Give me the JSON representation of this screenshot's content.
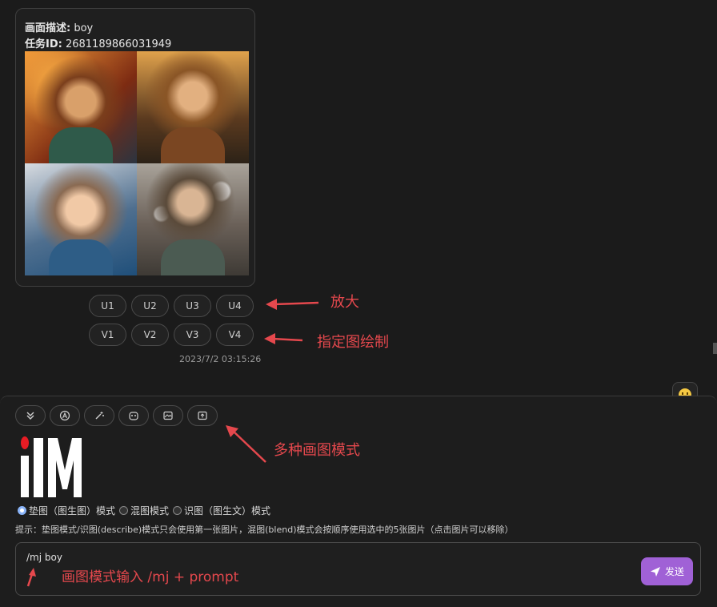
{
  "message": {
    "desc_label": "画面描述:",
    "desc_value": "boy",
    "task_label": "任务ID:",
    "task_value": "2681189866031949",
    "timestamp": "2023/7/2 03:15:26"
  },
  "upscale_buttons": [
    "U1",
    "U2",
    "U3",
    "U4"
  ],
  "variation_buttons": [
    "V1",
    "V2",
    "V3",
    "V4"
  ],
  "annotations": {
    "upscale": "放大",
    "variation": "指定图绘制",
    "modes": "多种画图模式",
    "input": "画图模式输入 /mj + prompt"
  },
  "toolbar": {
    "icons": [
      "chevrons-down-icon",
      "translate-icon",
      "magic-wand-icon",
      "mask-icon",
      "image-icon",
      "upload-image-icon"
    ]
  },
  "modes": {
    "option1": "垫图（图生图）模式",
    "option2": "混图模式",
    "option3": "识图（图生文）模式",
    "selected": "option1"
  },
  "tip": "提示：垫图模式/识图(describe)模式只会使用第一张图片，混图(blend)模式会按顺序使用选中的5张图片（点击图片可以移除）",
  "input": {
    "value": "/mj boy"
  },
  "send": {
    "label": "发送"
  },
  "colors": {
    "accent": "#a061d6",
    "annotation": "#e5484d",
    "radio_selected": "#8ab4f8"
  }
}
